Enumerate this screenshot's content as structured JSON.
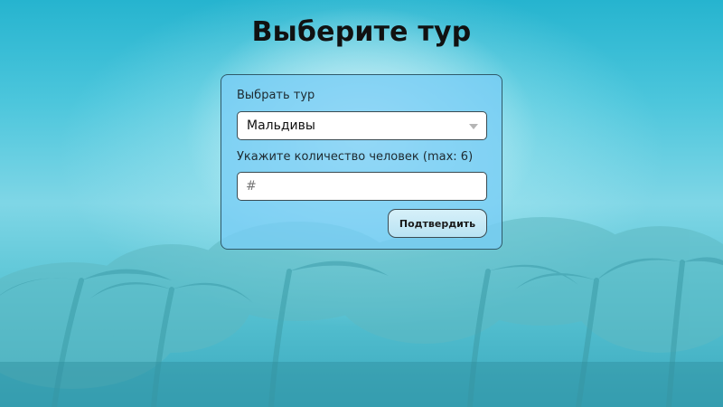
{
  "page": {
    "title": "Выберите тур"
  },
  "form": {
    "tour_label": "Выбрать тур",
    "tour_selected": "Мальдивы",
    "people_label": "Укажите количество человек (max: 6)",
    "people_placeholder": "#",
    "people_value": "",
    "confirm_label": "Подтвердить"
  },
  "icons": {
    "select_arrow": "chevron-down-icon"
  },
  "colors": {
    "card_background": "#78cdf5",
    "card_border": "#2f5a6a",
    "button_background": "#c8eaf6",
    "sky": "#4cc6dc"
  }
}
